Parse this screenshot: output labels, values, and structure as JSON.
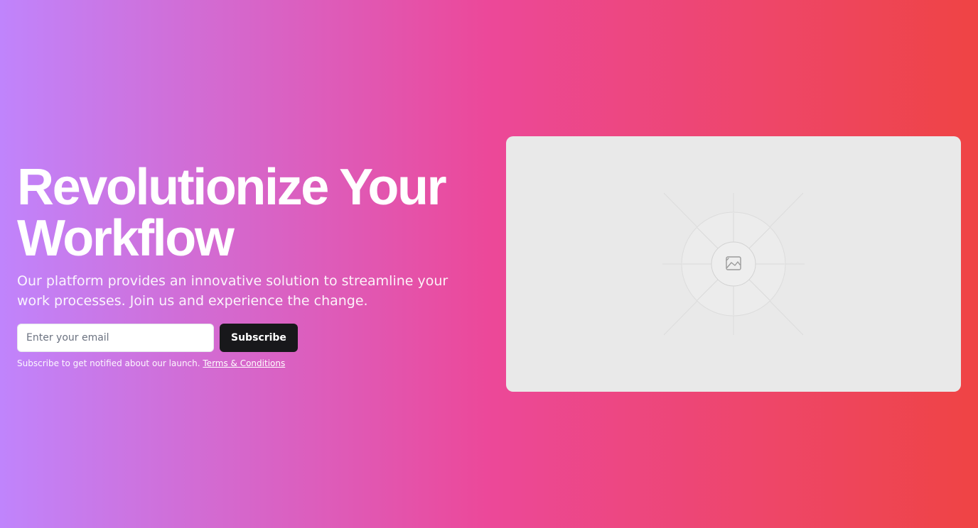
{
  "hero": {
    "title_line1": "Revolutionize Your",
    "title_line2": "Workflow",
    "subtitle": "Our platform provides an innovative solution to streamline your work processes. Join us and experience the change."
  },
  "signup": {
    "email_placeholder": "Enter your email",
    "email_value": "",
    "subscribe_label": "Subscribe",
    "helper_text": "Subscribe to get notified about our launch.",
    "terms_label": "Terms & Conditions"
  },
  "media": {
    "icon": "image-placeholder-icon"
  },
  "colors": {
    "gradient_start": "#c084fc",
    "gradient_mid": "#ec4899",
    "gradient_end": "#ef4444",
    "button_bg": "#18181b",
    "card_bg": "#e9e9e9"
  }
}
